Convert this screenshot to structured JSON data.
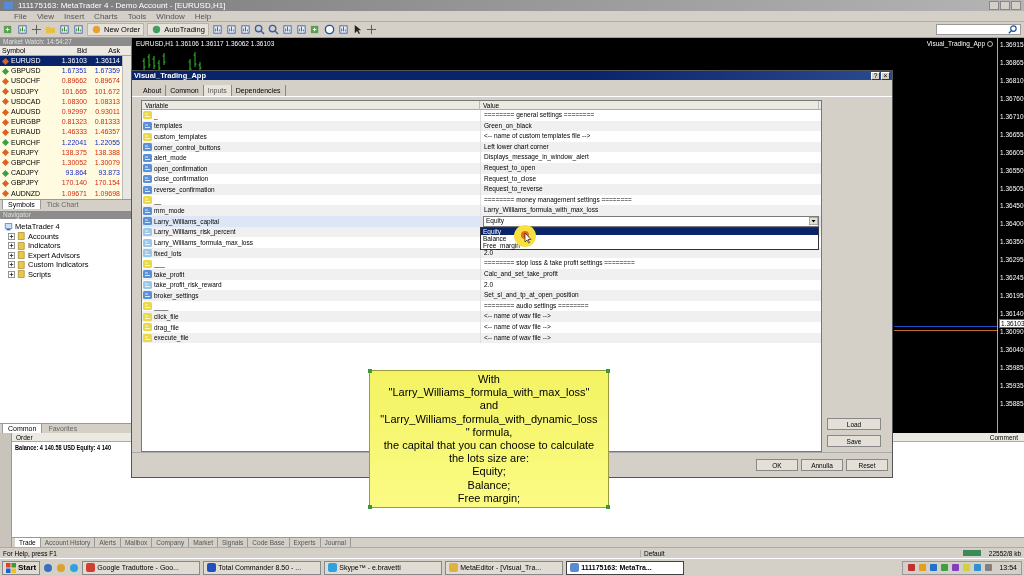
{
  "window": {
    "title": "111175163: MetaTrader 4 - Demo Account - [EURUSD,H1]"
  },
  "menu": [
    "File",
    "View",
    "Insert",
    "Charts",
    "Tools",
    "Window",
    "Help"
  ],
  "toolbar": {
    "buttons": [
      {
        "label": "New Order"
      },
      {
        "label": "AutoTrading"
      }
    ]
  },
  "market_watch": {
    "title": "Market Watch: 14:54:27",
    "columns": [
      "Symbol",
      "Bid",
      "Ask"
    ],
    "rows": [
      {
        "symbol": "EURUSD",
        "bid": "1.36103",
        "ask": "1.36114",
        "rising": false,
        "selected": true
      },
      {
        "symbol": "GBPUSD",
        "bid": "1.67351",
        "ask": "1.67359",
        "rising": true,
        "selected": false
      },
      {
        "symbol": "USDCHF",
        "bid": "0.89662",
        "ask": "0.89674",
        "rising": false,
        "selected": false
      },
      {
        "symbol": "USDJPY",
        "bid": "101.665",
        "ask": "101.672",
        "rising": false,
        "selected": false
      },
      {
        "symbol": "USDCAD",
        "bid": "1.08300",
        "ask": "1.08313",
        "rising": false,
        "selected": false
      },
      {
        "symbol": "AUDUSD",
        "bid": "0.92997",
        "ask": "0.93011",
        "rising": false,
        "selected": false
      },
      {
        "symbol": "EURGBP",
        "bid": "0.81323",
        "ask": "0.81333",
        "rising": false,
        "selected": false
      },
      {
        "symbol": "EURAUD",
        "bid": "1.46333",
        "ask": "1.46357",
        "rising": false,
        "selected": false
      },
      {
        "symbol": "EURCHF",
        "bid": "1.22041",
        "ask": "1.22055",
        "rising": true,
        "selected": false
      },
      {
        "symbol": "EURJPY",
        "bid": "138.375",
        "ask": "138.388",
        "rising": false,
        "selected": false
      },
      {
        "symbol": "GBPCHF",
        "bid": "1.30052",
        "ask": "1.30079",
        "rising": false,
        "selected": false
      },
      {
        "symbol": "CADJPY",
        "bid": "93.864",
        "ask": "93.873",
        "rising": true,
        "selected": false
      },
      {
        "symbol": "GBPJPY",
        "bid": "170.140",
        "ask": "170.154",
        "rising": false,
        "selected": false
      },
      {
        "symbol": "AUDNZD",
        "bid": "1.09671",
        "ask": "1.09698",
        "rising": false,
        "selected": false
      }
    ],
    "tabs": [
      {
        "label": "Symbols",
        "selected": true
      },
      {
        "label": "Tick Chart",
        "selected": false
      }
    ]
  },
  "navigator": {
    "title": "Navigator",
    "root": {
      "label": "MetaTrader 4",
      "children": [
        {
          "label": "Accounts",
          "expanded": false
        },
        {
          "label": "Indicators",
          "expanded": false
        },
        {
          "label": "Expert Advisors",
          "expanded": false
        },
        {
          "label": "Custom Indicators",
          "expanded": false
        },
        {
          "label": "Scripts",
          "expanded": false
        }
      ]
    },
    "tabs": [
      {
        "label": "Common",
        "selected": true
      },
      {
        "label": "Favorites",
        "selected": false
      }
    ]
  },
  "chart": {
    "header": "EURUSD,H1  1.36106 1.36117 1.36062 1.36103",
    "indicator": "Visual_Trading_App",
    "price_labels": [
      "1.36915",
      "1.36865",
      "1.36810",
      "1.36760",
      "1.36710",
      "1.36655",
      "1.36605",
      "1.36550",
      "1.36505",
      "1.36450",
      "1.36400",
      "1.36350",
      "1.36295",
      "1.36245",
      "1.36195",
      "1.36140",
      "1.36090",
      "1.36040",
      "1.35985",
      "1.35935",
      "1.35885"
    ],
    "current_price": "1.36103"
  },
  "dialog": {
    "title": "Visual_Trading_App",
    "help_button": "?",
    "close_button": "×",
    "tabs": [
      {
        "label": "About",
        "selected": false
      },
      {
        "label": "Common",
        "selected": false
      },
      {
        "label": "Inputs",
        "selected": true
      },
      {
        "label": "Dependencies",
        "selected": false
      }
    ],
    "columns": [
      "Variable",
      "Value"
    ],
    "rows": [
      {
        "kind": "string",
        "variable": "_",
        "value": "======== general settings ========",
        "selected": false
      },
      {
        "kind": "enum",
        "variable": "templates",
        "value": "Green_on_black",
        "selected": false
      },
      {
        "kind": "string",
        "variable": "custom_templates",
        "value": "<-- name of custom templates file -->",
        "selected": false
      },
      {
        "kind": "enum",
        "variable": "corner_control_buttons",
        "value": "Left lower chart corner",
        "selected": false
      },
      {
        "kind": "enum",
        "variable": "alert_mode",
        "value": "Displays_message_in_window_alert",
        "selected": false
      },
      {
        "kind": "enum",
        "variable": "open_confirmation",
        "value": "Request_to_open",
        "selected": false
      },
      {
        "kind": "enum",
        "variable": "close_confirmation",
        "value": "Request_to_close",
        "selected": false
      },
      {
        "kind": "enum",
        "variable": "reverse_confirmation",
        "value": "Request_to_reverse",
        "selected": false
      },
      {
        "kind": "string",
        "variable": "__",
        "value": "======== money management settings ========",
        "selected": false
      },
      {
        "kind": "enum",
        "variable": "mm_mode",
        "value": "Larry_Williams_formula_with_max_loss",
        "selected": false
      },
      {
        "kind": "enum",
        "variable": "Larry_Williams_capital",
        "value": "Equity",
        "selected": true,
        "dropdown": [
          {
            "label": "Equity",
            "selected": true
          },
          {
            "label": "Balance",
            "selected": false
          },
          {
            "label": "Free_margin",
            "selected": false
          }
        ]
      },
      {
        "kind": "number",
        "variable": "Larry_Williams_risk_percent",
        "selected": false
      },
      {
        "kind": "number",
        "variable": "Larry_Williams_formula_max_loss",
        "selected": false
      },
      {
        "kind": "number",
        "variable": "fixed_lots",
        "value": "2.0",
        "selected": false
      },
      {
        "kind": "string",
        "variable": "___",
        "value": "======== stop loss & take profit settings ========",
        "selected": false
      },
      {
        "kind": "enum",
        "variable": "take_profit",
        "value": "Calc_and_set_take_profit",
        "selected": false
      },
      {
        "kind": "number",
        "variable": "take_profit_risk_reward",
        "value": "2.0",
        "selected": false
      },
      {
        "kind": "enum",
        "variable": "broker_settings",
        "value": "Set_sl_and_tp_at_open_position",
        "selected": false
      },
      {
        "kind": "string",
        "variable": "____",
        "value": "======== audio settings ========",
        "selected": false
      },
      {
        "kind": "string",
        "variable": "click_file",
        "value": "<-- name of wav file -->",
        "selected": false
      },
      {
        "kind": "string",
        "variable": "drag_file",
        "value": "<-- name of wav file -->",
        "selected": false
      },
      {
        "kind": "string",
        "variable": "execute_file",
        "value": "<-- name of wav file -->",
        "selected": false
      }
    ],
    "side_buttons": [
      "Load",
      "Save"
    ],
    "footer_buttons": [
      "OK",
      "Annulla",
      "Reset"
    ]
  },
  "callout": {
    "lines": [
      "With",
      "\"Larry_Williams_formula_with_max_loss\"",
      "and",
      "\"Larry_Williams_formula_with_dynamic_loss",
      "\" formula,",
      "the capital that you can choose to calculate",
      "the lots size are:",
      "Equity;",
      "Balance;",
      "Free margin;"
    ]
  },
  "terminal": {
    "columns": [
      "Order",
      "Comment"
    ],
    "balance": "Balance: 4 140.58 USD  Equity: 4 140",
    "tabs": [
      {
        "label": "Trade",
        "selected": true
      },
      {
        "label": "Account History",
        "selected": false
      },
      {
        "label": "Alerts",
        "selected": false
      },
      {
        "label": "Mailbox",
        "selected": false
      },
      {
        "label": "Company",
        "selected": false
      },
      {
        "label": "Market",
        "selected": false
      },
      {
        "label": "Signals",
        "selected": false
      },
      {
        "label": "Code Base",
        "selected": false
      },
      {
        "label": "Experts",
        "selected": false
      },
      {
        "label": "Journal",
        "selected": false
      }
    ]
  },
  "status_bar": {
    "help": "For Help, press F1",
    "profile": "Default",
    "traffic": "22552/8 kb"
  },
  "taskbar": {
    "start": "Start",
    "items": [
      {
        "label": "Google Traduttore - Goo...",
        "selected": false
      },
      {
        "label": "Total Commander 8.50 - ...",
        "selected": false
      },
      {
        "label": "Skype™ - e.bravetti",
        "selected": false
      },
      {
        "label": "MetaEditor - [Visual_Tra...",
        "selected": false
      },
      {
        "label": "111175163: MetaTra...",
        "selected": true
      }
    ],
    "clock": "13:54"
  }
}
